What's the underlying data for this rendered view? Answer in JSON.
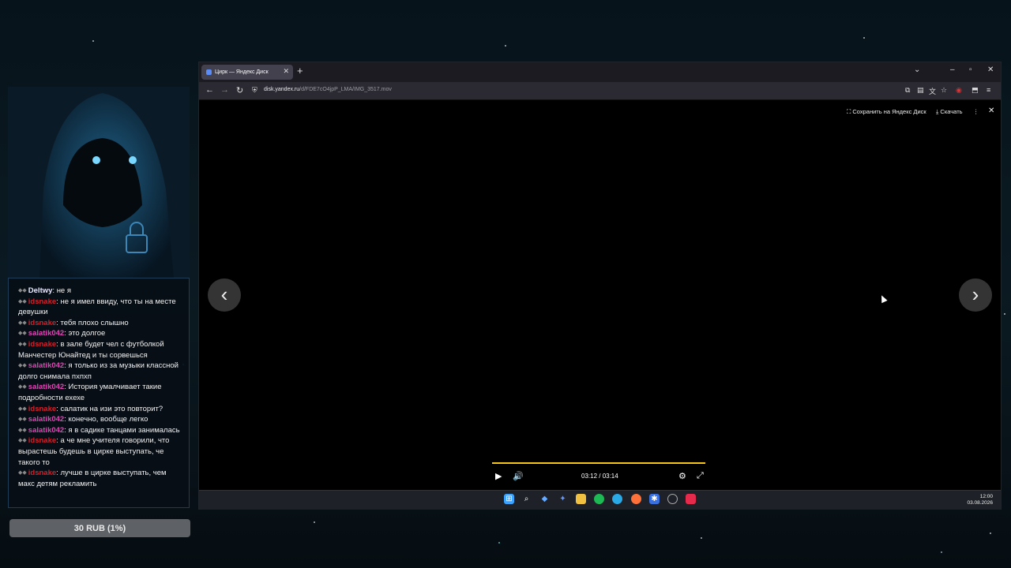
{
  "browser": {
    "tab_title": "Цирк — Яндекс Диск",
    "url_host": "disk.yandex.ru",
    "url_path": "/d/FDE7cO4jpP_LMA/IMG_3517.mov"
  },
  "viewer": {
    "save_label": "Сохранить на Яндекс Диск",
    "download_label": "Скачать",
    "time": "03:12 / 03:14",
    "progress": 0.99
  },
  "taskbar": {
    "time": "12:00",
    "date": "03.08.2026"
  },
  "chat": [
    {
      "user": "Deltwy",
      "color": "#e8e8ff",
      "text": "не я"
    },
    {
      "user": "idsnake",
      "color": "#d4202a",
      "text": "не я имел ввиду, что ты на месте девушки"
    },
    {
      "user": "idsnake",
      "color": "#d4202a",
      "text": "тебя плохо слышно"
    },
    {
      "user": "salatik042",
      "color": "#e045b6",
      "text": "это долгое"
    },
    {
      "user": "idsnake",
      "color": "#d4202a",
      "text": "в зале будет чел с футболкой Манчестер Юнайтед и ты сорвешься"
    },
    {
      "user": "salatik042",
      "color": "#e045b6",
      "text": "я только из за музыки классной долго снимала пхпхп"
    },
    {
      "user": "salatik042",
      "color": "#e045b6",
      "text": "История умалчивает такие подробности ехехе"
    },
    {
      "user": "idsnake",
      "color": "#d4202a",
      "text": "салатик на изи это повторит?"
    },
    {
      "user": "salatik042",
      "color": "#e045b6",
      "text": "конечно, вообще легко"
    },
    {
      "user": "salatik042",
      "color": "#e045b6",
      "text": "я в садике танцами занималась"
    },
    {
      "user": "idsnake",
      "color": "#d4202a",
      "text": "а че мне учителя говорили, что вырастешь будешь в цирке выступать, че такого то"
    },
    {
      "user": "idsnake",
      "color": "#d4202a",
      "text": "лучше в цирке выступать, чем макс детям рекламить"
    }
  ],
  "donation": {
    "label": "30 RUB (1%)"
  },
  "colors": {
    "accent_progress": "#f5c518",
    "chat_border": "#1e3c56"
  }
}
